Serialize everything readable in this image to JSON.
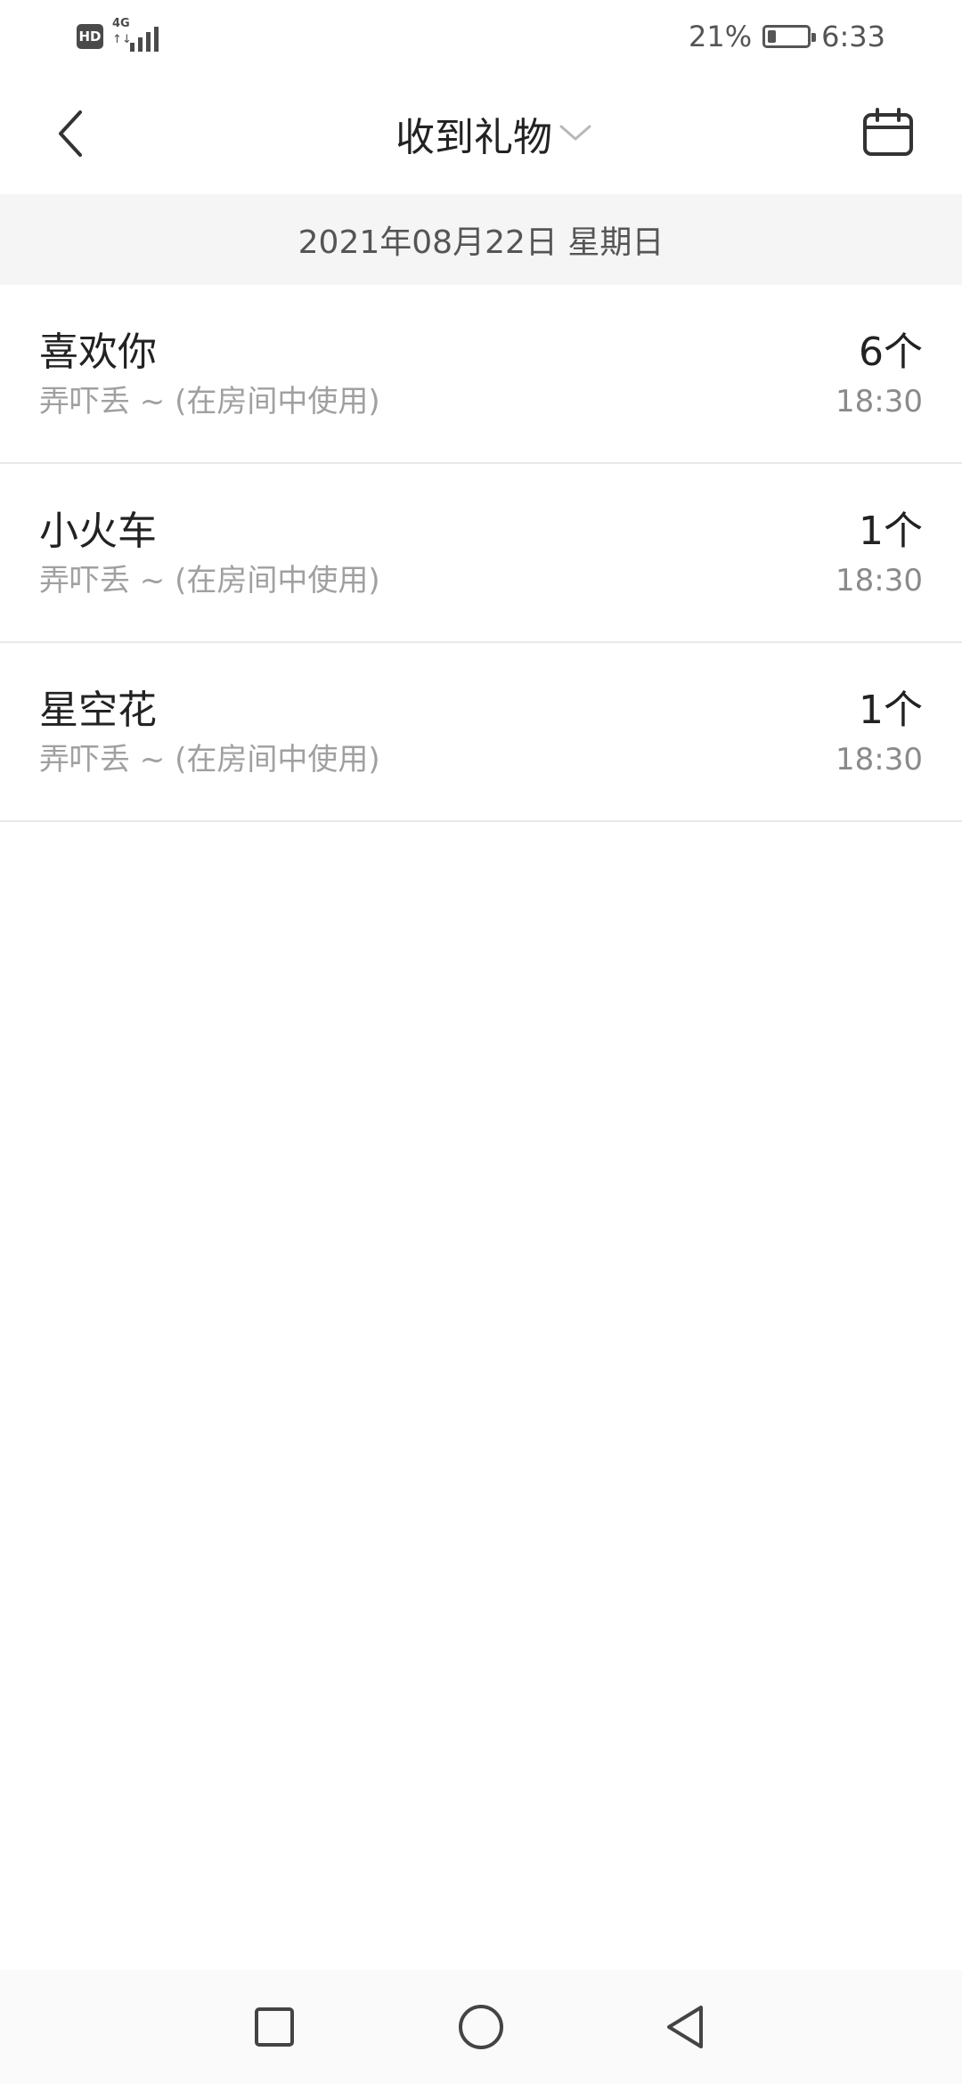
{
  "status_bar": {
    "hd_label": "HD",
    "network_label": "4G",
    "network_arrows": "↑↓",
    "battery_percent": "21%",
    "battery_level": 0.21,
    "time": "6:33"
  },
  "nav": {
    "title": "收到礼物",
    "back_icon": "chevron-left-icon",
    "dropdown_icon": "chevron-down-icon",
    "calendar_icon": "calendar-icon"
  },
  "date_header": "2021年08月22日 星期日",
  "gifts": [
    {
      "name": "喜欢你",
      "desc": "弄吓丢 ~ (在房间中使用)",
      "count": "6个",
      "time": "18:30"
    },
    {
      "name": "小火车",
      "desc": "弄吓丢 ~ (在房间中使用)",
      "count": "1个",
      "time": "18:30"
    },
    {
      "name": "星空花",
      "desc": "弄吓丢 ~ (在房间中使用)",
      "count": "1个",
      "time": "18:30"
    }
  ],
  "system_nav": {
    "recents_icon": "square-icon",
    "home_icon": "circle-icon",
    "back_icon": "triangle-back-icon"
  },
  "colors": {
    "background": "#ffffff",
    "date_header_bg": "#f5f5f5",
    "primary_text": "#222222",
    "secondary_text": "#a0a0a0",
    "divider": "#e8e8e8"
  }
}
